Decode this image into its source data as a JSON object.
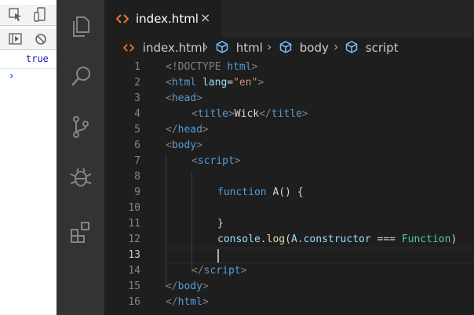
{
  "devtools": {
    "output_value": "true",
    "prompt_symbol": "›"
  },
  "tab": {
    "label": "index.html",
    "close": "×"
  },
  "breadcrumb": {
    "items": [
      "index.html",
      "html",
      "body",
      "script"
    ],
    "separator": "›"
  },
  "code": {
    "line_numbers": [
      "1",
      "2",
      "3",
      "4",
      "5",
      "6",
      "7",
      "8",
      "9",
      "10",
      "11",
      "12",
      "13",
      "14",
      "15",
      "16"
    ],
    "l1_a": "<!DOCTYPE",
    "l1_b": " html",
    "l1_c": ">",
    "l2_a": "<",
    "l2_b": "html",
    "l2_c": " lang",
    "l2_d": "=",
    "l2_e": "\"en\"",
    "l2_f": ">",
    "l3_a": "<",
    "l3_b": "head",
    "l3_c": ">",
    "l4_a": "<",
    "l4_b": "title",
    "l4_c": ">",
    "l4_d": "Wick",
    "l4_e": "</",
    "l4_f": "title",
    "l4_g": ">",
    "l5_a": "</",
    "l5_b": "head",
    "l5_c": ">",
    "l6_a": "<",
    "l6_b": "body",
    "l6_c": ">",
    "l7_a": "<",
    "l7_b": "script",
    "l7_c": ">",
    "l9_a": "function",
    "l9_b": " A",
    "l9_c": "() {",
    "l11_a": "}",
    "l12_a": "console",
    "l12_b": ".",
    "l12_c": "log",
    "l12_d": "(",
    "l12_e": "A",
    "l12_f": ".",
    "l12_g": "constructor",
    "l12_h": " === ",
    "l12_i": "Function",
    "l12_j": ")",
    "l14_a": "</",
    "l14_b": "script",
    "l14_c": ">",
    "l15_a": "</",
    "l15_b": "body",
    "l15_c": ">",
    "l16_a": "</",
    "l16_b": "html",
    "l16_c": ">"
  },
  "colors": {
    "tag": "#569cd6",
    "attr": "#9cdcfe",
    "string": "#ce9178",
    "function": "#dcdcaa",
    "type": "#4ec9b0",
    "html_icon": "#e37933",
    "cube_icon": "#75beff"
  },
  "icons": [
    "explorer-icon",
    "search-icon",
    "source-control-icon",
    "debug-icon",
    "extensions-icon"
  ]
}
